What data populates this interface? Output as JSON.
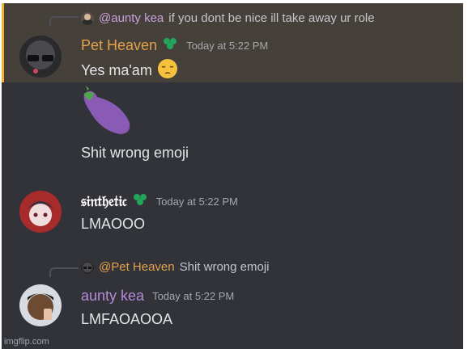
{
  "messages": [
    {
      "reply_mention": "@aunty kea",
      "reply_text": "if you dont be nice ill take away ur role",
      "author": "Pet Heaven",
      "timestamp": "Today at 5:22 PM",
      "text": "Yes ma'am",
      "emoji": "pensive-face-emoji",
      "author_color": "#e5a14a"
    },
    {
      "emoji": "eggplant-emoji"
    },
    {
      "text": "Shit wrong emoji"
    },
    {
      "author": "𝔰𝔦𝔫𝔱𝔥𝔢𝔱𝔦𝔠",
      "timestamp": "Today at 5:22 PM",
      "text": "LMAOOO",
      "author_color": "#ffffff"
    },
    {
      "reply_mention": "@Pet Heaven",
      "reply_text": "Shit wrong emoji",
      "author": "aunty kea",
      "timestamp": "Today at 5:22 PM",
      "text": "LMFAOAOOA",
      "author_color": "#b68ad8"
    }
  ],
  "watermark": "imgflip.com",
  "colors": {
    "background": "#313338",
    "highlight": "#45413a",
    "highlight_bar": "#f0b232",
    "badge": "#23a55a",
    "mention_purple": "#c9a0dc",
    "mention_orange": "#e5a14a"
  }
}
